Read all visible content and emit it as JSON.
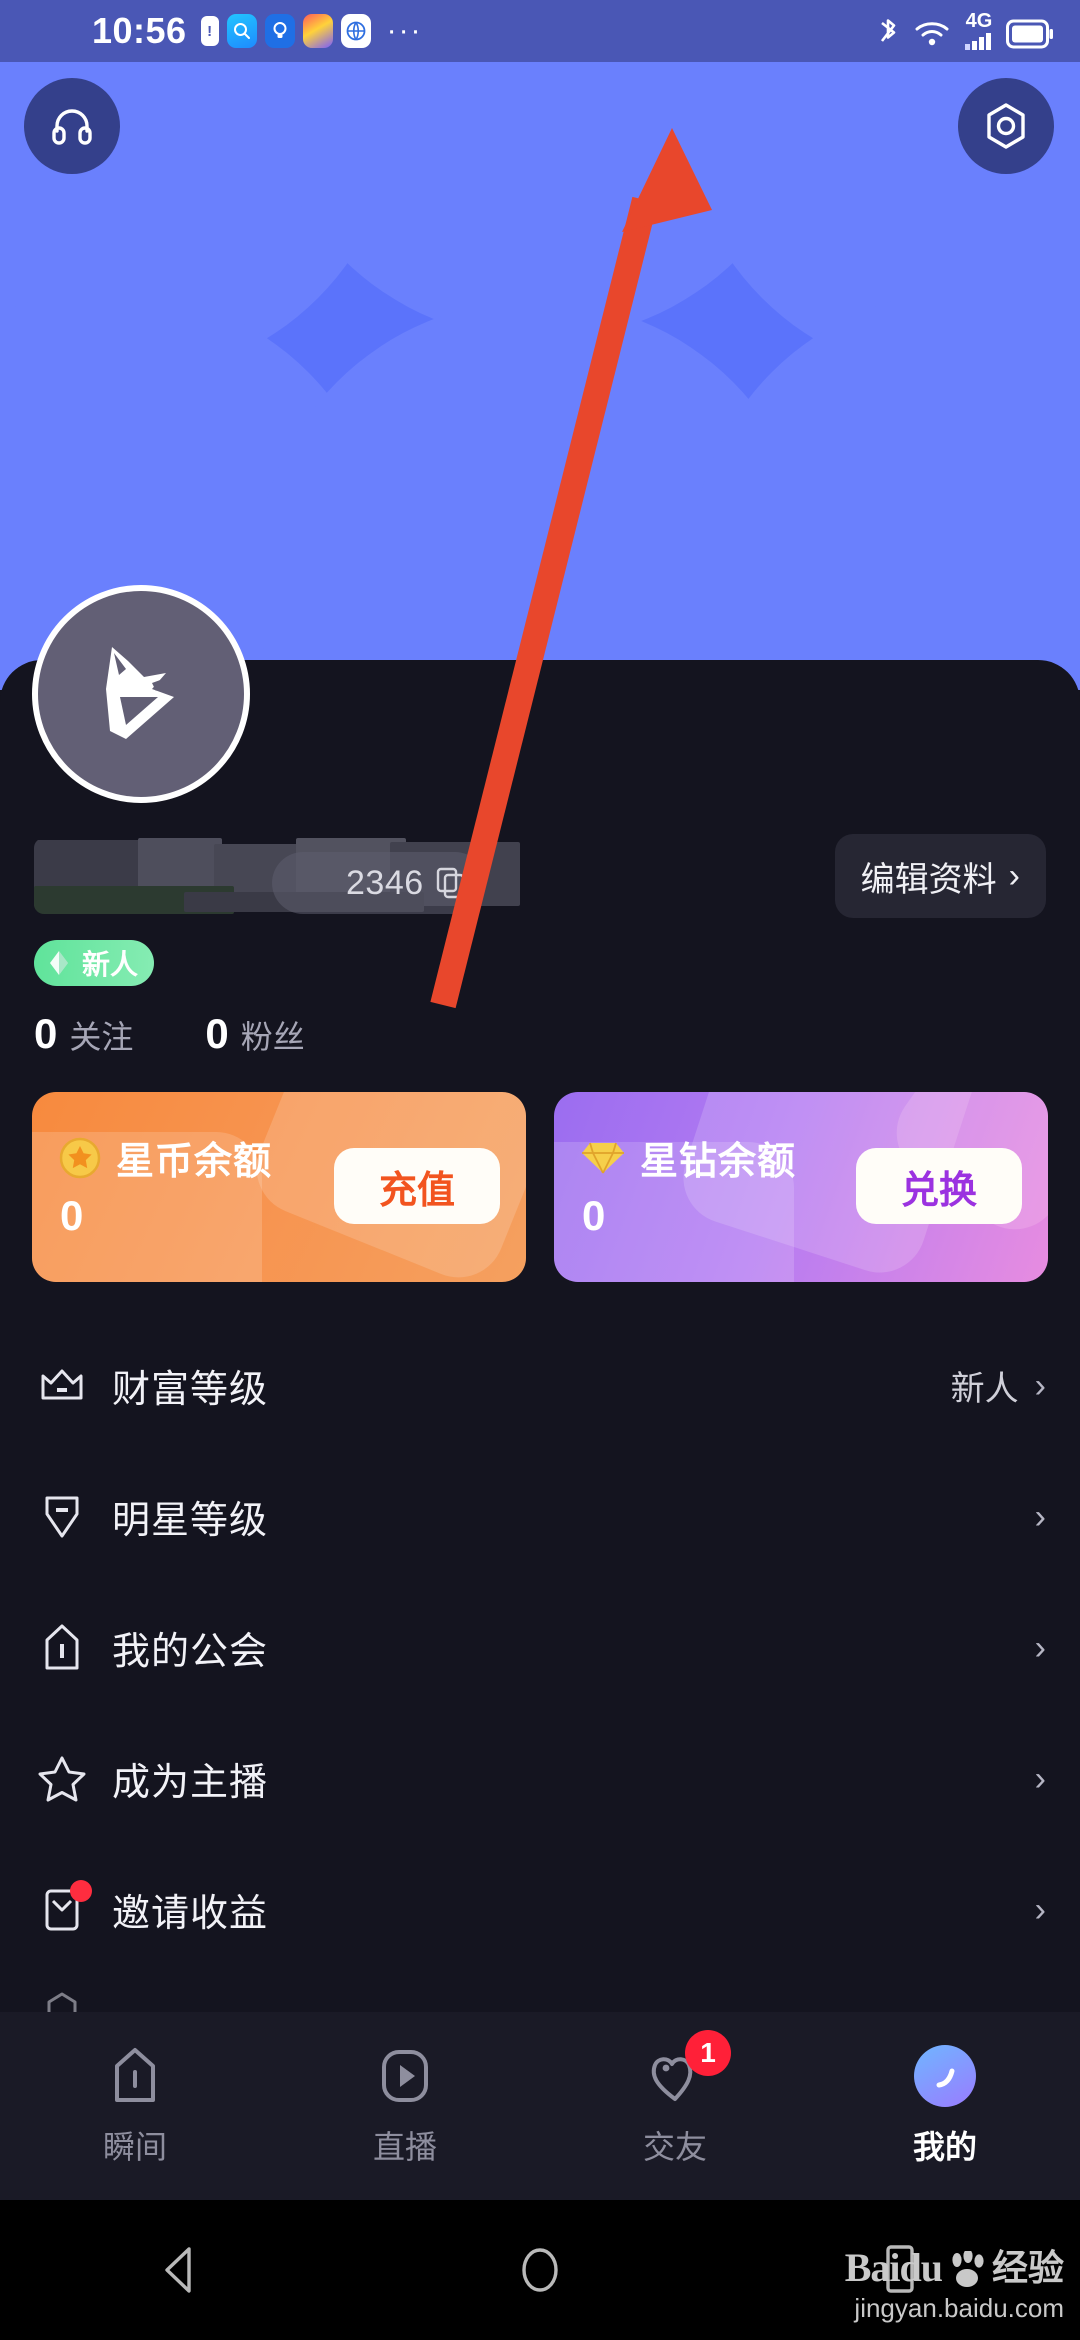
{
  "statusbar": {
    "time": "10:56",
    "icons": [
      "battery-icon",
      "search-app-icon",
      "bulb-app-icon",
      "paint-app-icon",
      "browser-app-icon"
    ],
    "overflow": "···",
    "right_icons": [
      "bluetooth-icon",
      "wifi-icon",
      "4g-icon",
      "signal-icon",
      "battery-status-icon"
    ],
    "network": "4G"
  },
  "banner": {
    "bg_color": "#5b73fb",
    "circle_color": "#6a80fd",
    "support_icon": "headphones-icon",
    "settings_icon": "hexagon-settings-icon"
  },
  "profile": {
    "avatar_icon": "fox-logo-avatar",
    "username_masked": "",
    "uid": "2346",
    "copy_icon": "copy-icon",
    "edit_label": "编辑资料",
    "edit_chevron": "›",
    "badge": {
      "label": "新人",
      "icon": "diamond-icon",
      "color": "#5fe39a"
    }
  },
  "stats": [
    {
      "value": "0",
      "label": "关注"
    },
    {
      "value": "0",
      "label": "粉丝"
    }
  ],
  "wallets": [
    {
      "icon": "gold-coin-icon",
      "title": "星币余额",
      "value": "0",
      "action": "充值",
      "gradient_from": "#f78a3e",
      "gradient_to": "#f5a05f",
      "action_color": "#f2541f"
    },
    {
      "icon": "diamond-gem-icon",
      "title": "星钻余额",
      "value": "0",
      "action": "兑换",
      "gradient_from": "#9b6df0",
      "gradient_to": "#e78ce0",
      "action_color": "#9b32e0"
    }
  ],
  "menu": [
    {
      "icon": "crown-icon",
      "label": "财富等级",
      "value": "新人",
      "chevron": "›",
      "dot": false
    },
    {
      "icon": "shield-icon",
      "label": "明星等级",
      "value": "",
      "chevron": "›",
      "dot": false
    },
    {
      "icon": "guild-icon",
      "label": "我的公会",
      "value": "",
      "chevron": "›",
      "dot": false
    },
    {
      "icon": "star-icon",
      "label": "成为主播",
      "value": "",
      "chevron": "›",
      "dot": false
    },
    {
      "icon": "invite-icon",
      "label": "邀请收益",
      "value": "",
      "chevron": "›",
      "dot": true
    }
  ],
  "bottomnav": [
    {
      "icon": "moments-icon",
      "label": "瞬间",
      "badge": "",
      "active": false
    },
    {
      "icon": "live-icon",
      "label": "直播",
      "badge": "",
      "active": false
    },
    {
      "icon": "heart-icon",
      "label": "交友",
      "badge": "1",
      "active": false
    },
    {
      "icon": "profile-avatar-icon",
      "label": "我的",
      "badge": "",
      "active": true
    }
  ],
  "sysbar": {
    "back_icon": "back-triangle-icon",
    "home_icon": "home-circle-icon",
    "recents_icon": "recents-square-icon"
  },
  "watermark": {
    "brand": "Baidu",
    "paw_icon": "paw-icon",
    "suffix": "经验",
    "url": "jingyan.baidu.com"
  },
  "annotation": {
    "type": "arrow",
    "color": "#e8472c",
    "points_to": "hexagon-settings-icon"
  }
}
